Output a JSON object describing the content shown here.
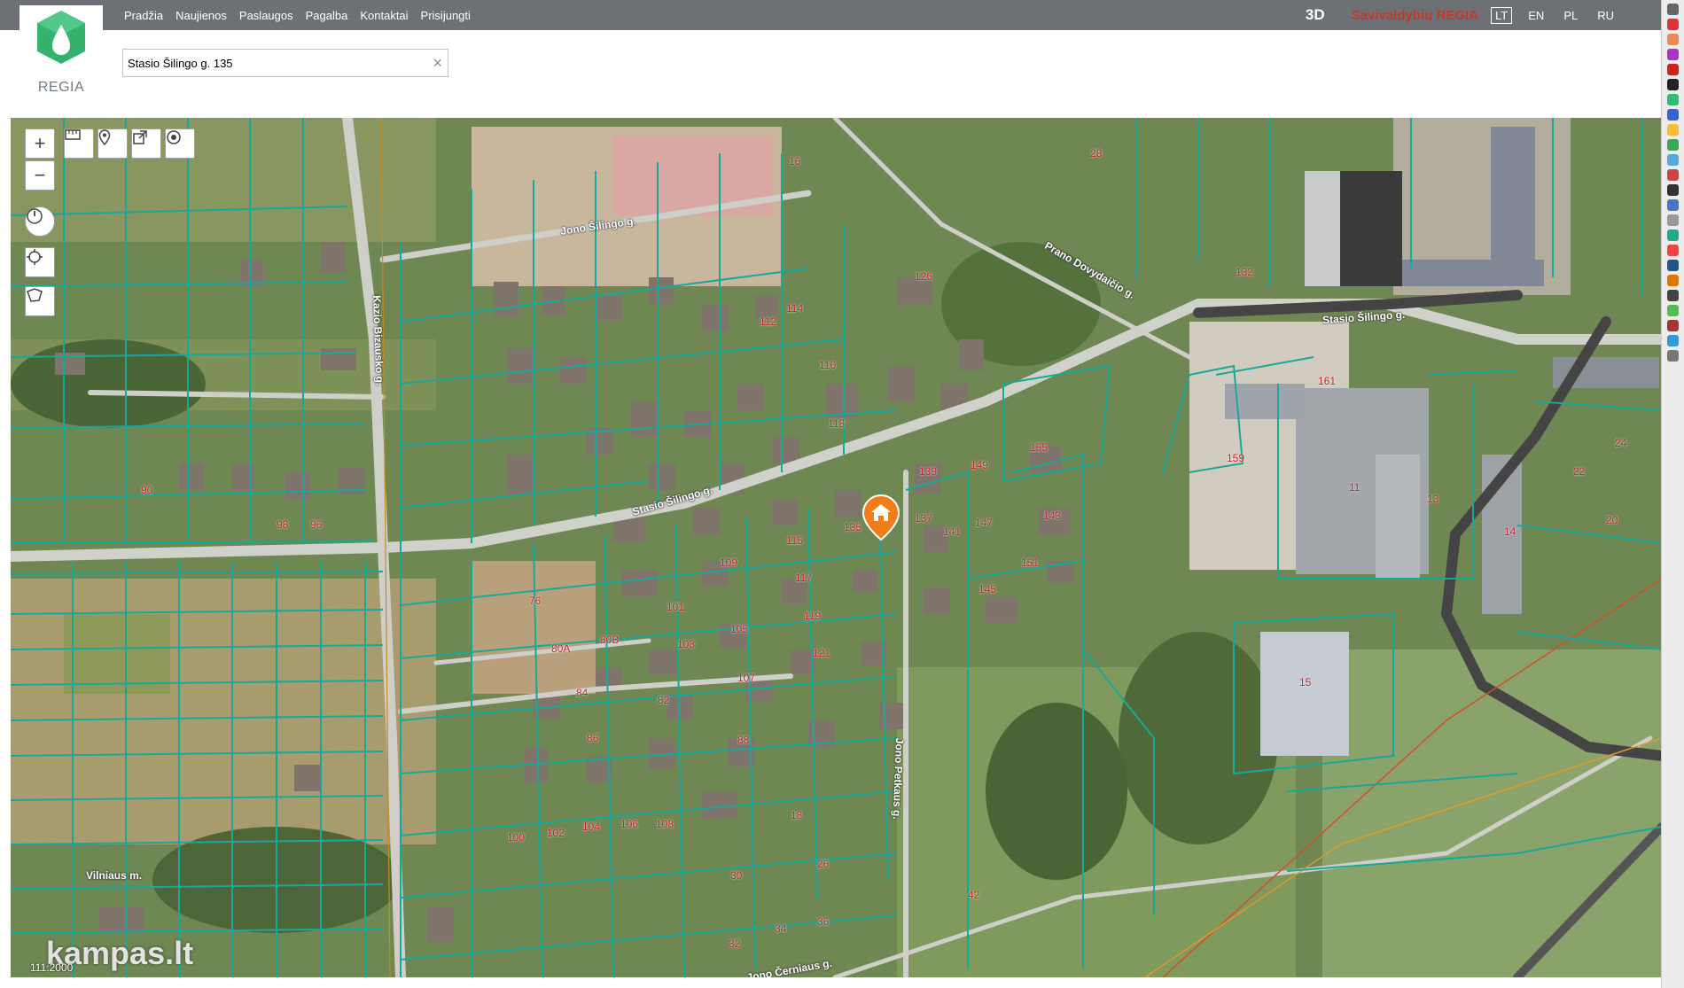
{
  "header": {
    "nav_items": [
      "Pradžia",
      "Naujienos",
      "Paslaugos",
      "Pagalba",
      "Kontaktai",
      "Prisijungti"
    ],
    "mode_3d": "3D",
    "brand": "Savivaldybių REGIA",
    "languages": [
      "LT",
      "EN",
      "PL",
      "RU"
    ],
    "active_language": "LT"
  },
  "logo": {
    "text": "REGIA",
    "color": "#35b36e"
  },
  "search": {
    "value": "Stasio Šilingo g. 135",
    "clear_symbol": "×"
  },
  "map": {
    "colors": {
      "parcel_line": "#18a89a",
      "parcel_label": "#c2252a",
      "marker": "#f07d1a",
      "street": "#cfcfca",
      "railway": "#444444"
    },
    "streets": [
      "Jono Šilingo g.",
      "Prano Dovydaičio g.",
      "Stasio Šilingo g.",
      "Stasio Šilingo g.",
      "Kazio Bizausko g.",
      "Jono Petkaus g.",
      "Vilniaus m.",
      "Jono Černiaus g."
    ],
    "parcel_labels": [
      "126",
      "114",
      "116",
      "118",
      "112",
      "149",
      "151",
      "155",
      "159",
      "161",
      "132",
      "135",
      "137",
      "139",
      "141",
      "143",
      "145",
      "147",
      "115",
      "117",
      "119",
      "121",
      "101",
      "103",
      "105",
      "107",
      "109",
      "76",
      "80A",
      "80B",
      "82",
      "84",
      "86",
      "88",
      "90",
      "96",
      "98",
      "100",
      "102",
      "104",
      "106",
      "108",
      "11",
      "13",
      "14",
      "15",
      "16",
      "18",
      "20",
      "22",
      "24",
      "26",
      "28",
      "30",
      "32",
      "34",
      "36",
      "42"
    ],
    "marker_icon": "home-icon"
  },
  "watermark": {
    "text": "kampas.lt",
    "scale": "111:2000"
  }
}
